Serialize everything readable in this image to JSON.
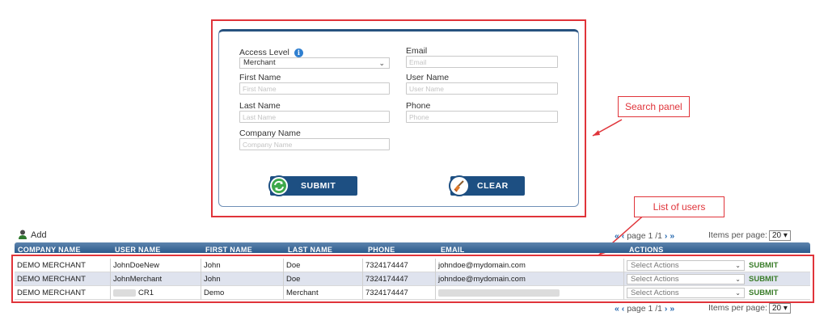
{
  "search": {
    "access_level_label": "Access Level",
    "access_level_value": "Merchant",
    "first_name_label": "First Name",
    "first_name_placeholder": "First Name",
    "last_name_label": "Last Name",
    "last_name_placeholder": "Last Name",
    "company_name_label": "Company Name",
    "company_name_placeholder": "Company Name",
    "email_label": "Email",
    "email_placeholder": "Email",
    "user_name_label": "User Name",
    "user_name_placeholder": "User Name",
    "phone_label": "Phone",
    "phone_placeholder": "Phone",
    "submit_label": "SUBMIT",
    "clear_label": "CLEAR"
  },
  "annotations": {
    "search_panel": "Search panel",
    "list_of_users": "List of users"
  },
  "list": {
    "add_label": "Add",
    "pager_text": "page 1 /1",
    "pager_prev": "« ‹",
    "pager_next": "› »",
    "items_per_page_label": "Items per page:",
    "items_per_page_value": "20",
    "columns": [
      "COMPANY NAME",
      "USER NAME",
      "FIRST NAME",
      "LAST NAME",
      "PHONE",
      "EMAIL",
      "ACTIONS"
    ],
    "rows": [
      {
        "company": "DEMO MERCHANT",
        "user": "JohnDoeNew",
        "first": "John",
        "last": "Doe",
        "phone": "7324174447",
        "email": "johndoe@mydomain.com",
        "action": "Select Actions",
        "submit": "SUBMIT"
      },
      {
        "company": "DEMO MERCHANT",
        "user": "JohnMerchant",
        "first": "John",
        "last": "Doe",
        "phone": "7324174447",
        "email": "johndoe@mydomain.com",
        "action": "Select Actions",
        "submit": "SUBMIT"
      },
      {
        "company": "DEMO MERCHANT",
        "user": "CR1",
        "first": "Demo",
        "last": "Merchant",
        "phone": "7324174447",
        "email": "",
        "action": "Select Actions",
        "submit": "SUBMIT"
      }
    ]
  },
  "colors": {
    "accent": "#1d4f82",
    "annotation_red": "#e0343a",
    "submit_green": "#3a7d2a"
  }
}
